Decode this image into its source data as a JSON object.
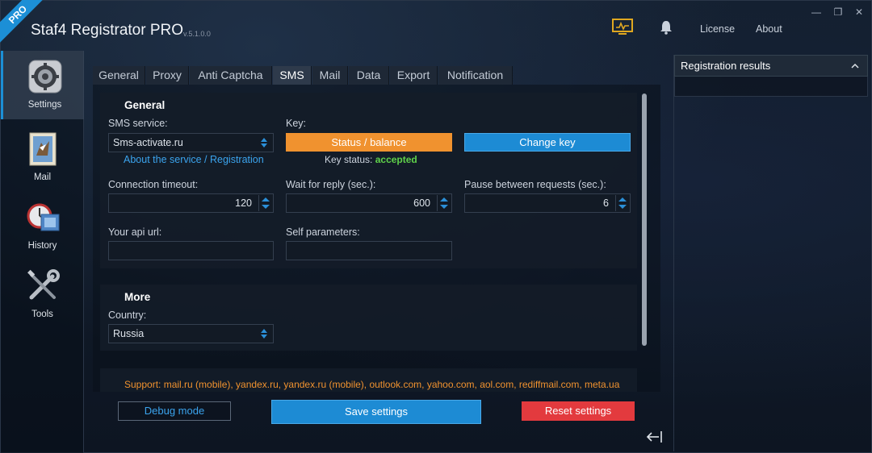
{
  "app": {
    "badge": "PRO",
    "title": "Staf4 Registrator PRO",
    "version": "v.5.1.0.0",
    "links": {
      "license": "License",
      "about": "About"
    },
    "window_controls": {
      "minimize": "—",
      "restore": "❐",
      "close": "✕"
    }
  },
  "sidebar": {
    "items": [
      {
        "label": "Settings",
        "icon": "gear-icon",
        "active": true
      },
      {
        "label": "Mail",
        "icon": "mail-stamp-icon",
        "active": false
      },
      {
        "label": "History",
        "icon": "clock-icon",
        "active": false
      },
      {
        "label": "Tools",
        "icon": "tools-icon",
        "active": false
      }
    ]
  },
  "tabs": [
    {
      "label": "General",
      "active": false
    },
    {
      "label": "Proxy",
      "active": false
    },
    {
      "label": "Anti Captcha",
      "active": false
    },
    {
      "label": "SMS",
      "active": true
    },
    {
      "label": "Mail",
      "active": false
    },
    {
      "label": "Data",
      "active": false
    },
    {
      "label": "Export",
      "active": false
    },
    {
      "label": "Notification",
      "active": false
    }
  ],
  "general_section": {
    "title": "General",
    "sms_service_label": "SMS service:",
    "sms_service_value": "Sms-activate.ru",
    "about_link": "About the service / Registration",
    "key_label": "Key:",
    "status_button": "Status / balance",
    "change_key_button": "Change key",
    "key_status_label": "Key status:",
    "key_status_value": "accepted",
    "connection_timeout_label": "Connection timeout:",
    "connection_timeout_value": "120",
    "wait_reply_label": "Wait for reply (sec.):",
    "wait_reply_value": "600",
    "pause_label": "Pause between requests (sec.):",
    "pause_value": "6",
    "api_url_label": "Your api url:",
    "api_url_value": "",
    "self_params_label": "Self parameters:",
    "self_params_value": ""
  },
  "more_section": {
    "title": "More",
    "country_label": "Country:",
    "country_value": "Russia"
  },
  "support_text": "Support: mail.ru (mobile), yandex.ru, yandex.ru (mobile), outlook.com, yahoo.com, aol.com, rediffmail.com, meta.ua",
  "footer": {
    "debug_button": "Debug mode",
    "save_button": "Save settings",
    "reset_button": "Reset settings"
  },
  "results": {
    "title": "Registration results"
  },
  "colors": {
    "accent_blue": "#1d8bd4",
    "orange": "#f0922f",
    "red": "#e33a3e",
    "green": "#5fd14a"
  }
}
